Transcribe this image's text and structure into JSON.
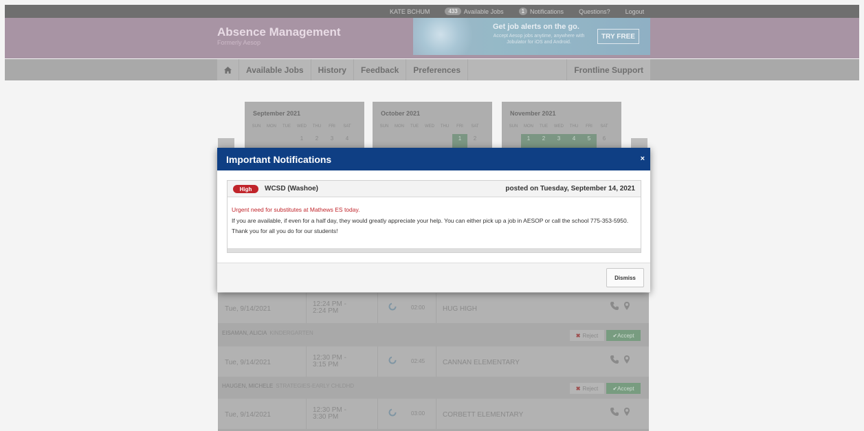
{
  "topbar": {
    "user": "KATE BCHUM",
    "available_count": "433",
    "available_label": "Available Jobs",
    "notifications_count": "1",
    "notifications_label": "Notifications",
    "questions": "Questions?",
    "logout": "Logout"
  },
  "brand": {
    "title": "Absence Management",
    "subtitle": "Formerly Aesop"
  },
  "promo": {
    "headline": "Get job alerts on the go.",
    "sub": "Accept Aesop jobs anytime, anywhere with Jobulator for iOS and Android.",
    "button": "TRY FREE"
  },
  "nav": {
    "tabs": [
      "Available Jobs",
      "History",
      "Feedback",
      "Preferences"
    ],
    "support": "Frontline Support"
  },
  "calendars": [
    {
      "month": "September 2021",
      "days": [
        "",
        "",
        "",
        "1",
        "2",
        "3",
        "4"
      ],
      "active": []
    },
    {
      "month": "October 2021",
      "days": [
        "",
        "",
        "",
        "",
        "",
        "1",
        "2"
      ],
      "active": [
        5
      ]
    },
    {
      "month": "November 2021",
      "days": [
        "",
        "1",
        "2",
        "3",
        "4",
        "5",
        "6"
      ],
      "active": [
        1,
        2,
        3,
        4,
        5
      ]
    }
  ],
  "weekdays": [
    "SUN",
    "MON",
    "TUE",
    "WED",
    "THU",
    "FRI",
    "SAT"
  ],
  "jobs": [
    {
      "date": "Tue, 9/14/2021",
      "time_start": "12:24 PM -",
      "time_end": "2:24 PM",
      "duration": "02:00",
      "location": "HUG HIGH"
    },
    {
      "date": "Tue, 9/14/2021",
      "time_start": "12:30 PM -",
      "time_end": "3:15 PM",
      "duration": "02:45",
      "location": "CANNAN ELEMENTARY"
    },
    {
      "date": "Tue, 9/14/2021",
      "time_start": "12:30 PM -",
      "time_end": "3:30 PM",
      "duration": "03:00",
      "location": "CORBETT ELEMENTARY"
    }
  ],
  "employees": [
    {
      "name": "EISAMAN, ALICIA",
      "role": "KINDERGARTEN"
    },
    {
      "name": "HAUGEN, MICHELE",
      "role": "STRATEGIES-EARLY CHLDHD"
    }
  ],
  "actions": {
    "reject": "Reject",
    "accept": "Accept"
  },
  "modal": {
    "title": "Important Notifications",
    "close": "×",
    "priority": "High",
    "org": "WCSD (Washoe)",
    "posted": "posted on Tuesday, September 14, 2021",
    "urgent": "Urgent need for substitutes at Mathews ES today.",
    "paragraph": "If you are available, if even for a half day, they would greatly appreciate your help.  You can either pick up a job in AESOP or  call the school 775-353-5950.",
    "thanks": "Thank you for all you do for our students!",
    "dismiss": "Dismiss"
  },
  "colors": {
    "modal_header": "#0f3f84",
    "badge_high": "#c0242a",
    "urgent_text": "#c0242a"
  }
}
